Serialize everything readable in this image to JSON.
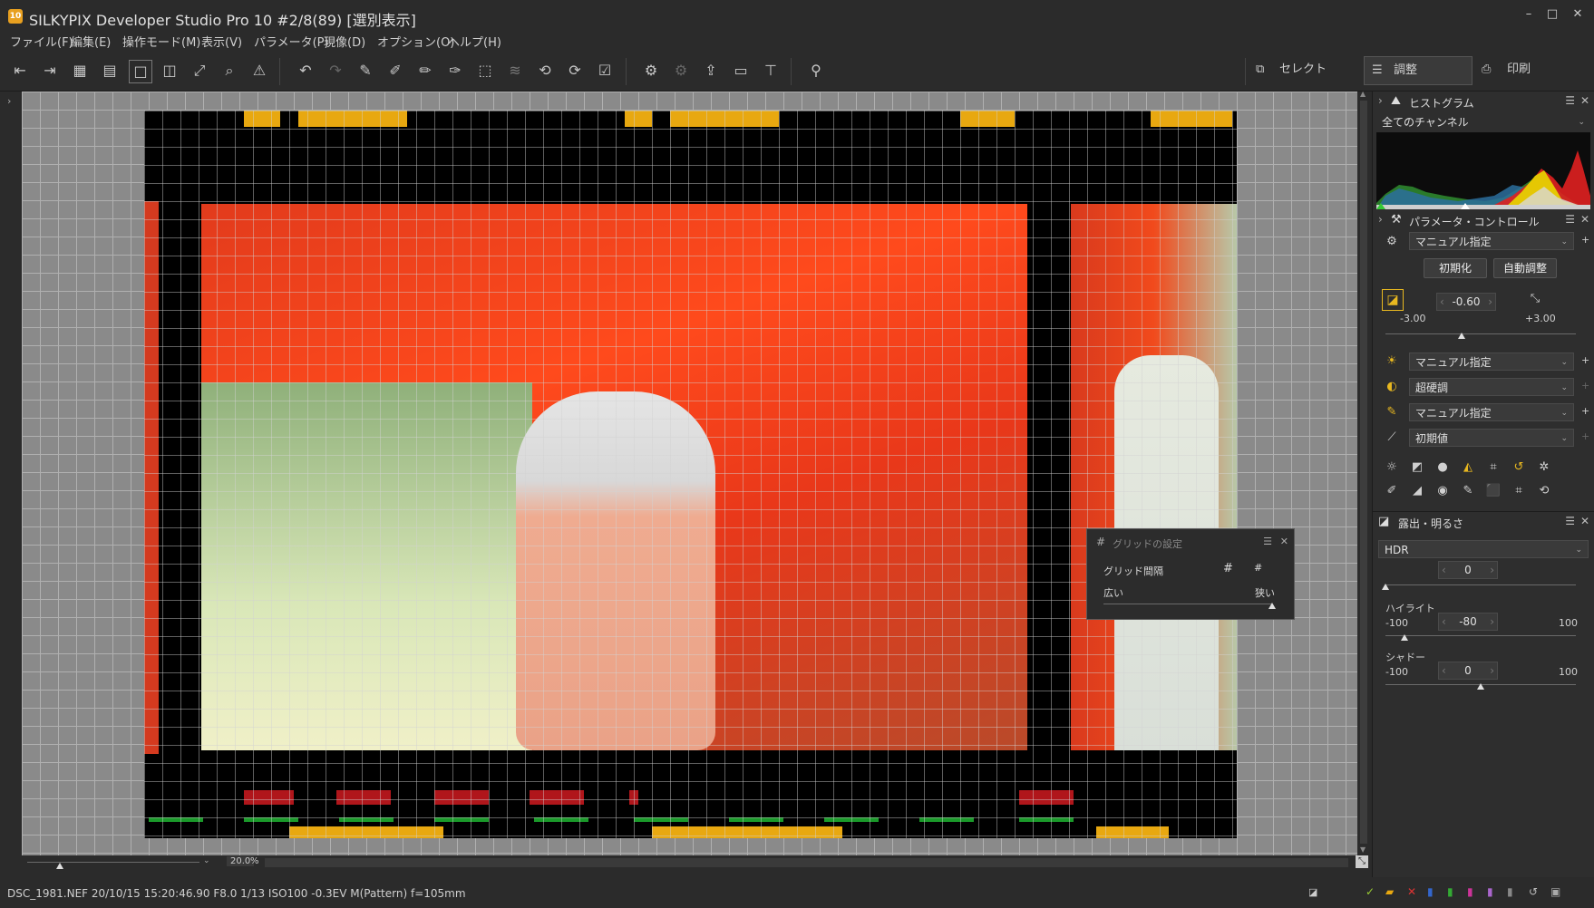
{
  "window": {
    "app_icon": "10",
    "title": "SILKYPIX Developer Studio Pro 10   #2/8(89) [選別表示]",
    "controls": [
      "–",
      "□",
      "✕"
    ]
  },
  "menu": [
    "ファイル(F)",
    "編集(E)",
    "操作モード(M)",
    "表示(V)",
    "パラメータ(P)",
    "現像(D)",
    "オプション(O)",
    "ヘルプ(H)"
  ],
  "modes": {
    "select": "セレクト",
    "adjust": "調整",
    "print": "印刷"
  },
  "histogram": {
    "title": "ヒストグラム",
    "channel": "全てのチャンネル"
  },
  "param_control": {
    "title": "パラメータ・コントロール",
    "preset": "マニュアル指定",
    "reset_btn": "初期化",
    "auto_btn": "自動調整",
    "exposure_value": "-0.60",
    "exposure_min": "-3.00",
    "exposure_max": "+3.00",
    "exposure_fraction": 0.4,
    "wb": "マニュアル指定",
    "tone": "超硬調",
    "sharp": "マニュアル指定",
    "noise": "初期値"
  },
  "exposure_panel": {
    "title": "露出・明るさ",
    "mode": "HDR",
    "hdr_value": "0",
    "hdr_fraction": 0.0,
    "highlight_label": "ハイライト",
    "highlight_value": "-80",
    "highlight_min": "-100",
    "highlight_max": "100",
    "highlight_fraction": 0.1,
    "shadow_label": "シャドー",
    "shadow_value": "0",
    "shadow_min": "-100",
    "shadow_max": "100",
    "shadow_fraction": 0.5
  },
  "grid_dialog": {
    "title": "グリッドの設定",
    "label": "グリッド間隔",
    "wide": "広い",
    "narrow": "狭い",
    "level": 1.0
  },
  "zoom": {
    "value": "20.0",
    "unit": "%"
  },
  "status": {
    "text": "DSC_1981.NEF 20/10/15 15:20:46.90 F8.0 1/13 ISO100 -0.3EV M(Pattern) f=105mm"
  },
  "colors": {
    "accent": "#e8a810",
    "film_red": "#b0161b",
    "film_green": "#1a9a2a"
  }
}
